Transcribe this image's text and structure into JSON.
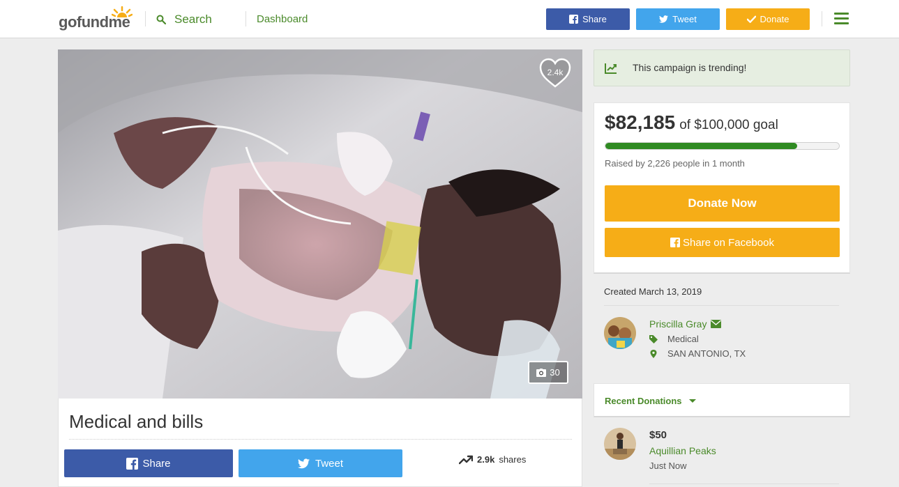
{
  "header": {
    "logo": "gofundme",
    "search_label": "Search",
    "dashboard_label": "Dashboard",
    "share_label": "Share",
    "tweet_label": "Tweet",
    "donate_label": "Donate"
  },
  "hero": {
    "likes": "2.4k",
    "photo_count": "30"
  },
  "campaign": {
    "title": "Medical and bills",
    "share_label": "Share",
    "tweet_label": "Tweet",
    "shares_count": "2.9k",
    "shares_label": "shares"
  },
  "sidebar": {
    "trending_text": "This campaign is trending!",
    "raised_amount": "$82,185",
    "goal_text": "of $100,000 goal",
    "progress_fraction": 0.82,
    "raised_by": "Raised by 2,226 people in 1 month",
    "donate_now_label": "Donate Now",
    "share_facebook_label": "Share on Facebook",
    "created": "Created March 13, 2019",
    "organizer_name": "Priscilla Gray",
    "category": "Medical",
    "location": "SAN ANTONIO, TX",
    "recent_donations_label": "Recent Donations",
    "donation": {
      "amount": "$50",
      "name": "Aquillian Peaks",
      "time": "Just Now"
    }
  },
  "colors": {
    "brand_green": "#4a8a2a",
    "facebook_blue": "#3c5ba8",
    "twitter_blue": "#42a5ec",
    "donate_orange": "#f6ad17",
    "progress_green": "#2f8a22"
  }
}
